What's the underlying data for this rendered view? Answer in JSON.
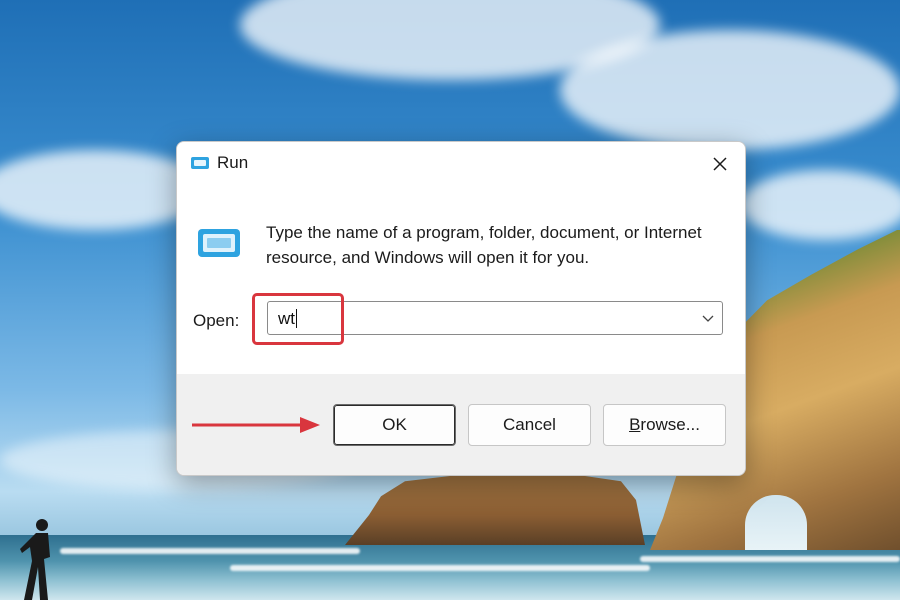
{
  "dialog": {
    "title": "Run",
    "description": "Type the name of a program, folder, document, or Internet resource, and Windows will open it for you.",
    "open_label": "Open:",
    "open_value": "wt",
    "buttons": {
      "ok": "OK",
      "cancel": "Cancel",
      "browse": "Browse..."
    }
  },
  "icons": {
    "title": "run-app-icon",
    "close": "close-icon",
    "run": "run-app-icon",
    "dropdown": "chevron-down-icon"
  },
  "colors": {
    "annotation_red": "#d9363e",
    "dialog_bg": "#f0f0f0",
    "run_icon_blue": "#2ea3e0"
  }
}
